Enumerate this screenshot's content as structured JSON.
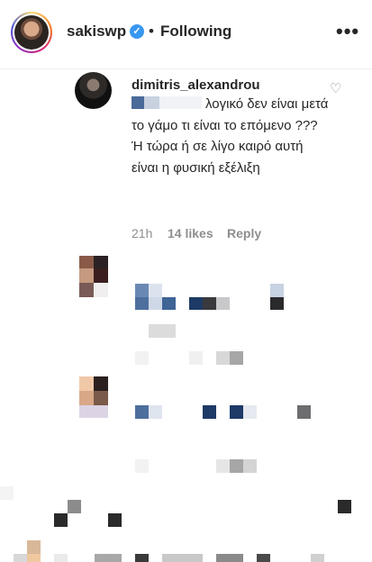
{
  "header": {
    "username": "sakiswp",
    "dot": "•",
    "following": "Following",
    "verified": "✓",
    "more": "•••"
  },
  "comment": {
    "username": "dimitris_alexandrou",
    "text": "λογικό δεν είναι μετά το γάμο τι είναι το επόμενο ??? Ή τώρα ή σε λίγο καιρό αυτή είναι η φυσική εξέλιξη",
    "time": "21h",
    "likes": "14 likes",
    "reply": "Reply"
  },
  "icons": {
    "heart": "♡"
  }
}
